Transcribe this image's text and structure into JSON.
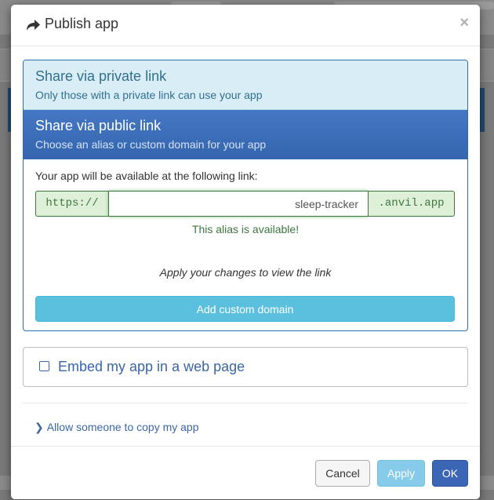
{
  "modal": {
    "title": "Publish app",
    "title_icon": "share-arrow-icon",
    "close_label": "×"
  },
  "private_link": {
    "heading": "Share via private link",
    "subtext": "Only those with a private link can use your app"
  },
  "public_link": {
    "heading": "Share via public link",
    "subtext": "Choose an alias or custom domain for your app",
    "availability_label": "Your app will be available at the following link:",
    "prefix": "https://",
    "alias_value": "sleep-tracker",
    "suffix": ".anvil.app",
    "status_message": "This alias is available!",
    "apply_hint": "Apply your changes to view the link",
    "custom_domain_button": "Add custom domain"
  },
  "embed": {
    "label": "Embed my app in a web page",
    "checked": false
  },
  "copy": {
    "label": "Allow someone to copy my app",
    "icon": "chevron-right-icon"
  },
  "footer": {
    "cancel_label": "Cancel",
    "apply_label": "Apply",
    "ok_label": "OK"
  },
  "colors": {
    "primary": "#3a66b5",
    "info": "#5bc0de",
    "success": "#3c763d",
    "public_header": "#3e6fb9"
  }
}
